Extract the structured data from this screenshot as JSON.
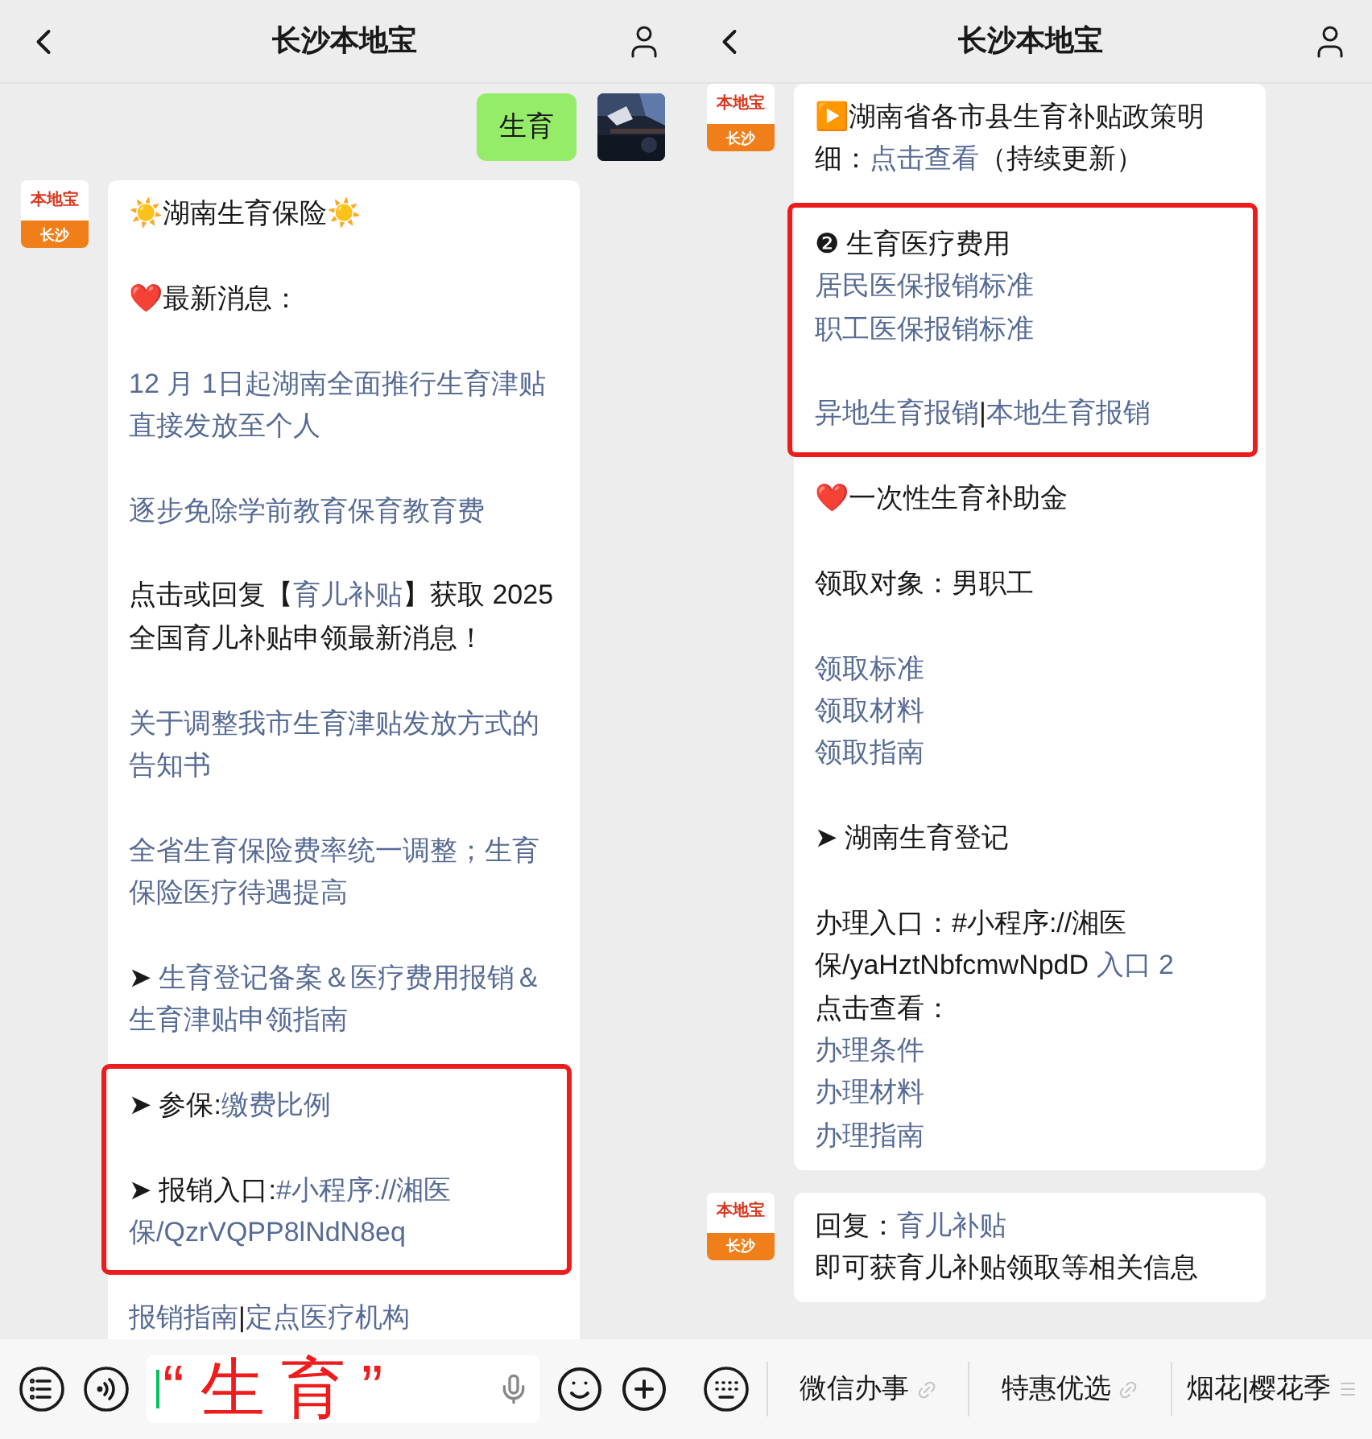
{
  "panels": [
    {
      "title": "长沙本地宝",
      "messages": [
        {
          "kind": "sent",
          "text": "生育"
        },
        {
          "kind": "received",
          "logo": {
            "name": "本地宝",
            "city": "长沙"
          },
          "sections": [
            {
              "highlighted": false,
              "groups": [
                [
                  [
                    {
                      "text": "☀️湖南生育保险☀️",
                      "link": false
                    }
                  ]
                ],
                [
                  [
                    {
                      "text": "❤️最新消息：",
                      "link": false
                    }
                  ]
                ],
                [
                  [
                    {
                      "text": "12 月 1日起湖南全面推行生育津贴直接发放至个人",
                      "link": true
                    }
                  ]
                ],
                [
                  [
                    {
                      "text": "逐步免除学前教育保育教育费",
                      "link": true
                    }
                  ]
                ],
                [
                  [
                    {
                      "text": "点击或回复【",
                      "link": false
                    },
                    {
                      "text": "育儿补贴",
                      "link": true
                    },
                    {
                      "text": "】获取 2025 全国育儿补贴申领最新消息！",
                      "link": false
                    }
                  ]
                ],
                [
                  [
                    {
                      "text": "关于调整我市生育津贴发放方式的告知书",
                      "link": true
                    }
                  ]
                ],
                [
                  [
                    {
                      "text": "全省生育保险费率统一调整；生育保险医疗待遇提高",
                      "link": true
                    }
                  ]
                ],
                [
                  [
                    {
                      "text": "➤ ",
                      "link": false
                    },
                    {
                      "text": "生育登记备案＆医疗费用报销＆生育津贴申领指南",
                      "link": true
                    }
                  ]
                ]
              ]
            },
            {
              "highlighted": true,
              "groups": [
                [
                  [
                    {
                      "text": "➤ 参保:",
                      "link": false
                    },
                    {
                      "text": "缴费比例",
                      "link": true
                    }
                  ]
                ],
                [
                  [
                    {
                      "text": "➤ 报销入口:",
                      "link": false
                    },
                    {
                      "text": "#小程序://湘医保/QzrVQPP8lNdN8eq",
                      "link": true
                    }
                  ]
                ]
              ]
            },
            {
              "highlighted": false,
              "groups": [
                [
                  [
                    {
                      "text": "报销指南",
                      "link": true
                    },
                    {
                      "text": "|",
                      "link": false
                    },
                    {
                      "text": "定点医疗机构",
                      "link": true
                    }
                  ]
                ]
              ]
            }
          ]
        }
      ],
      "bottom_bar": {
        "kind": "input",
        "overlay_text": "“生育”"
      }
    },
    {
      "title": "长沙本地宝",
      "messages": [
        {
          "kind": "received",
          "logo": {
            "name": "本地宝",
            "city": "长沙"
          },
          "sections": [
            {
              "highlighted": false,
              "groups": [
                [
                  [
                    {
                      "text": "▶️湖南省各市县生育补贴政策明细：",
                      "link": false
                    },
                    {
                      "text": "点击查看",
                      "link": true
                    },
                    {
                      "text": "（持续更新）",
                      "link": false
                    }
                  ]
                ]
              ]
            },
            {
              "highlighted": true,
              "groups": [
                [
                  [
                    {
                      "text": "❷ 生育医疗费用",
                      "link": false
                    }
                  ],
                  [
                    {
                      "text": "居民医保报销标准",
                      "link": true
                    }
                  ],
                  [
                    {
                      "text": "职工医保报销标准",
                      "link": true
                    }
                  ]
                ],
                [
                  [
                    {
                      "text": "异地生育报销",
                      "link": true
                    },
                    {
                      "text": "|",
                      "link": false
                    },
                    {
                      "text": "本地生育报销",
                      "link": true
                    }
                  ]
                ]
              ]
            },
            {
              "highlighted": false,
              "groups": [
                [
                  [
                    {
                      "text": "❤️一次性生育补助金",
                      "link": false
                    }
                  ]
                ],
                [
                  [
                    {
                      "text": "领取对象：男职工",
                      "link": false
                    }
                  ]
                ],
                [
                  [
                    {
                      "text": "领取标准",
                      "link": true
                    }
                  ],
                  [
                    {
                      "text": "领取材料",
                      "link": true
                    }
                  ],
                  [
                    {
                      "text": "领取指南",
                      "link": true
                    }
                  ]
                ],
                [
                  [
                    {
                      "text": "➤ 湖南生育登记",
                      "link": false
                    }
                  ]
                ],
                [
                  [
                    {
                      "text": "办理入口：#小程序://湘医保/yaHztNbfcmwNpdD ",
                      "link": false
                    },
                    {
                      "text": "入口 2",
                      "link": true
                    }
                  ],
                  [
                    {
                      "text": "点击查看：",
                      "link": false
                    }
                  ],
                  [
                    {
                      "text": "办理条件",
                      "link": true
                    }
                  ],
                  [
                    {
                      "text": "办理材料",
                      "link": true
                    }
                  ],
                  [
                    {
                      "text": "办理指南",
                      "link": true
                    }
                  ]
                ]
              ]
            }
          ]
        },
        {
          "kind": "received",
          "logo": {
            "name": "本地宝",
            "city": "长沙"
          },
          "sections": [
            {
              "highlighted": false,
              "groups": [
                [
                  [
                    {
                      "text": "回复：",
                      "link": false
                    },
                    {
                      "text": "育儿补贴",
                      "link": true
                    }
                  ],
                  [
                    {
                      "text": "即可获育儿补贴领取等相关信息",
                      "link": false
                    }
                  ]
                ]
              ]
            }
          ]
        }
      ],
      "bottom_bar": {
        "kind": "menu",
        "items": [
          {
            "label": "微信办事",
            "kind": "link"
          },
          {
            "label": "特惠优选",
            "kind": "link"
          },
          {
            "label": "烟花|樱花季",
            "kind": "submenu"
          }
        ]
      }
    }
  ]
}
